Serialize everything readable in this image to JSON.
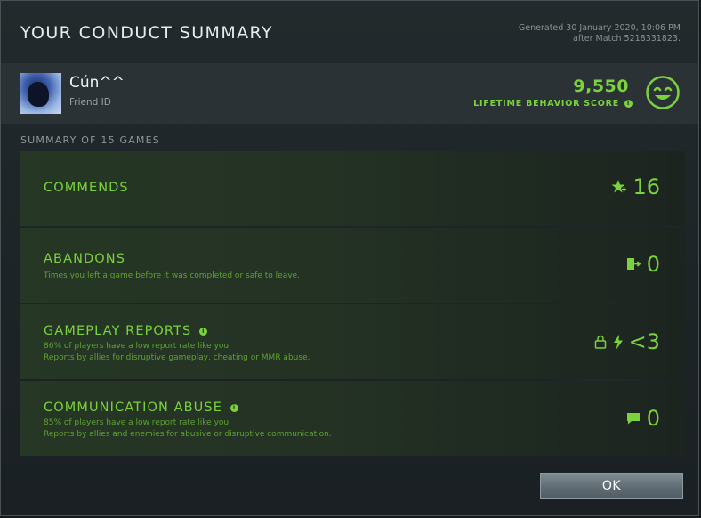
{
  "dialog": {
    "title": "YOUR CONDUCT SUMMARY",
    "generated_line1": "Generated 30 January 2020, 10:06 PM",
    "generated_line2": "after Match 5218331823."
  },
  "profile": {
    "name": "Cún^^",
    "friend_id_label": "Friend ID",
    "score": "9,550",
    "score_label": "LIFETIME BEHAVIOR SCORE",
    "info_icon": "info-icon",
    "face_icon": "smiley-face-icon"
  },
  "summary": {
    "header": "SUMMARY OF 15 GAMES",
    "rows": [
      {
        "title": "COMMENDS",
        "desc1": "",
        "desc2": "",
        "value": "16",
        "icon": "star-plus-icon"
      },
      {
        "title": "ABANDONS",
        "desc1": "Times you left a game before it was completed or safe to leave.",
        "desc2": "",
        "value": "0",
        "icon": "exit-door-icon"
      },
      {
        "title": "GAMEPLAY REPORTS",
        "desc1": "86% of players have a low report rate like you.",
        "desc2": "Reports by allies for disruptive gameplay, cheating or MMR abuse.",
        "value": "<3",
        "icon": "lock-and-lightning-icon"
      },
      {
        "title": "COMMUNICATION ABUSE",
        "desc1": "85% of players have a low report rate like you.",
        "desc2": "Reports by allies and enemies for abusive or disruptive communication.",
        "value": "0",
        "icon": "chat-bubble-icon"
      }
    ]
  },
  "buttons": {
    "ok_label": "OK"
  },
  "colors": {
    "accent_green": "#7bd23c",
    "desc_green": "#5fa232",
    "background": "#1d2427"
  }
}
